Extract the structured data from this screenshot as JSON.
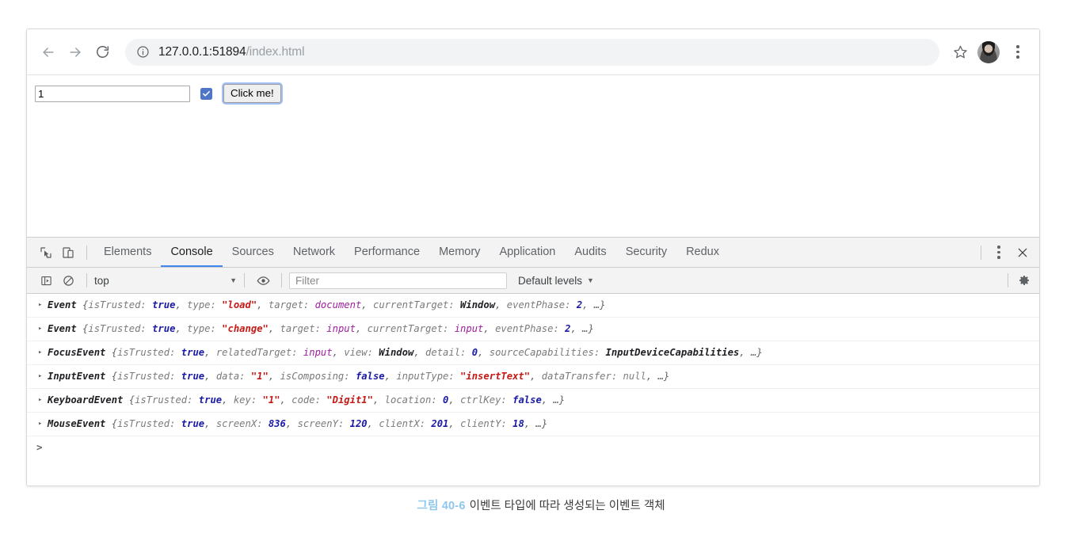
{
  "browser": {
    "back_label": "back-arrow",
    "forward_label": "forward-arrow",
    "reload_label": "reload",
    "url_host": "127.0.0.1:51894",
    "url_path": "/index.html",
    "security_icon": "info-circle-icon",
    "bookmark_icon": "star-icon",
    "profile_icon": "avatar",
    "menu_icon": "three-dot-menu-icon"
  },
  "page": {
    "input_value": "1",
    "input_placeholder": "",
    "checkbox_checked": true,
    "button_label": "Click me!"
  },
  "devtools": {
    "inspect_icon": "inspect-element-icon",
    "device_icon": "device-toolbar-icon",
    "tabs": [
      {
        "label": "Elements",
        "active": false
      },
      {
        "label": "Console",
        "active": true
      },
      {
        "label": "Sources",
        "active": false
      },
      {
        "label": "Network",
        "active": false
      },
      {
        "label": "Performance",
        "active": false
      },
      {
        "label": "Memory",
        "active": false
      },
      {
        "label": "Application",
        "active": false
      },
      {
        "label": "Audits",
        "active": false
      },
      {
        "label": "Security",
        "active": false
      },
      {
        "label": "Redux",
        "active": false
      }
    ],
    "more_icon": "more-options-icon",
    "close_icon": "close-icon",
    "toolbar": {
      "sidebar_icon": "console-sidebar-icon",
      "clear_icon": "clear-console-icon",
      "context": "top",
      "context_caret": "▼",
      "eye_icon": "live-expression-icon",
      "filter_placeholder": "Filter",
      "filter_value": "",
      "levels_label": "Default levels",
      "levels_caret": "▼",
      "settings_icon": "gear-icon"
    },
    "accent_color": "#4285f4",
    "messages": [
      {
        "arrow": "▸",
        "parts": [
          {
            "t": "cls",
            "v": "Event"
          },
          {
            "t": "punc",
            "v": " {"
          },
          {
            "t": "key",
            "v": "isTrusted: "
          },
          {
            "t": "bool",
            "v": "true"
          },
          {
            "t": "punc",
            "v": ", "
          },
          {
            "t": "key",
            "v": "type: "
          },
          {
            "t": "str",
            "v": "\"load\""
          },
          {
            "t": "punc",
            "v": ", "
          },
          {
            "t": "key",
            "v": "target: "
          },
          {
            "t": "ref",
            "v": "document"
          },
          {
            "t": "punc",
            "v": ", "
          },
          {
            "t": "key",
            "v": "currentTarget: "
          },
          {
            "t": "objref",
            "v": "Window"
          },
          {
            "t": "punc",
            "v": ", "
          },
          {
            "t": "key",
            "v": "eventPhase: "
          },
          {
            "t": "num",
            "v": "2"
          },
          {
            "t": "punc",
            "v": ", …}"
          }
        ]
      },
      {
        "arrow": "▸",
        "parts": [
          {
            "t": "cls",
            "v": "Event"
          },
          {
            "t": "punc",
            "v": " {"
          },
          {
            "t": "key",
            "v": "isTrusted: "
          },
          {
            "t": "bool",
            "v": "true"
          },
          {
            "t": "punc",
            "v": ", "
          },
          {
            "t": "key",
            "v": "type: "
          },
          {
            "t": "str",
            "v": "\"change\""
          },
          {
            "t": "punc",
            "v": ", "
          },
          {
            "t": "key",
            "v": "target: "
          },
          {
            "t": "ref",
            "v": "input"
          },
          {
            "t": "punc",
            "v": ", "
          },
          {
            "t": "key",
            "v": "currentTarget: "
          },
          {
            "t": "ref",
            "v": "input"
          },
          {
            "t": "punc",
            "v": ", "
          },
          {
            "t": "key",
            "v": "eventPhase: "
          },
          {
            "t": "num",
            "v": "2"
          },
          {
            "t": "punc",
            "v": ", …}"
          }
        ]
      },
      {
        "arrow": "▸",
        "parts": [
          {
            "t": "cls",
            "v": "FocusEvent"
          },
          {
            "t": "punc",
            "v": " {"
          },
          {
            "t": "key",
            "v": "isTrusted: "
          },
          {
            "t": "bool",
            "v": "true"
          },
          {
            "t": "punc",
            "v": ", "
          },
          {
            "t": "key",
            "v": "relatedTarget: "
          },
          {
            "t": "ref",
            "v": "input"
          },
          {
            "t": "punc",
            "v": ", "
          },
          {
            "t": "key",
            "v": "view: "
          },
          {
            "t": "objref",
            "v": "Window"
          },
          {
            "t": "punc",
            "v": ", "
          },
          {
            "t": "key",
            "v": "detail: "
          },
          {
            "t": "num",
            "v": "0"
          },
          {
            "t": "punc",
            "v": ", "
          },
          {
            "t": "key",
            "v": "sourceCapabilities: "
          },
          {
            "t": "objref",
            "v": "InputDeviceCapabilities"
          },
          {
            "t": "punc",
            "v": ", …}"
          }
        ]
      },
      {
        "arrow": "▸",
        "parts": [
          {
            "t": "cls",
            "v": "InputEvent"
          },
          {
            "t": "punc",
            "v": " {"
          },
          {
            "t": "key",
            "v": "isTrusted: "
          },
          {
            "t": "bool",
            "v": "true"
          },
          {
            "t": "punc",
            "v": ", "
          },
          {
            "t": "key",
            "v": "data: "
          },
          {
            "t": "str",
            "v": "\"1\""
          },
          {
            "t": "punc",
            "v": ", "
          },
          {
            "t": "key",
            "v": "isComposing: "
          },
          {
            "t": "bool",
            "v": "false"
          },
          {
            "t": "punc",
            "v": ", "
          },
          {
            "t": "key",
            "v": "inputType: "
          },
          {
            "t": "str",
            "v": "\"insertText\""
          },
          {
            "t": "punc",
            "v": ", "
          },
          {
            "t": "key",
            "v": "dataTransfer: "
          },
          {
            "t": "nul",
            "v": "null"
          },
          {
            "t": "punc",
            "v": ", …}"
          }
        ]
      },
      {
        "arrow": "▸",
        "parts": [
          {
            "t": "cls",
            "v": "KeyboardEvent"
          },
          {
            "t": "punc",
            "v": " {"
          },
          {
            "t": "key",
            "v": "isTrusted: "
          },
          {
            "t": "bool",
            "v": "true"
          },
          {
            "t": "punc",
            "v": ", "
          },
          {
            "t": "key",
            "v": "key: "
          },
          {
            "t": "str",
            "v": "\"1\""
          },
          {
            "t": "punc",
            "v": ", "
          },
          {
            "t": "key",
            "v": "code: "
          },
          {
            "t": "str",
            "v": "\"Digit1\""
          },
          {
            "t": "punc",
            "v": ", "
          },
          {
            "t": "key",
            "v": "location: "
          },
          {
            "t": "num",
            "v": "0"
          },
          {
            "t": "punc",
            "v": ", "
          },
          {
            "t": "key",
            "v": "ctrlKey: "
          },
          {
            "t": "bool",
            "v": "false"
          },
          {
            "t": "punc",
            "v": ", …}"
          }
        ]
      },
      {
        "arrow": "▸",
        "parts": [
          {
            "t": "cls",
            "v": "MouseEvent"
          },
          {
            "t": "punc",
            "v": " {"
          },
          {
            "t": "key",
            "v": "isTrusted: "
          },
          {
            "t": "bool",
            "v": "true"
          },
          {
            "t": "punc",
            "v": ", "
          },
          {
            "t": "key",
            "v": "screenX: "
          },
          {
            "t": "num",
            "v": "836"
          },
          {
            "t": "punc",
            "v": ", "
          },
          {
            "t": "key",
            "v": "screenY: "
          },
          {
            "t": "num",
            "v": "120"
          },
          {
            "t": "punc",
            "v": ", "
          },
          {
            "t": "key",
            "v": "clientX: "
          },
          {
            "t": "num",
            "v": "201"
          },
          {
            "t": "punc",
            "v": ", "
          },
          {
            "t": "key",
            "v": "clientY: "
          },
          {
            "t": "num",
            "v": "18"
          },
          {
            "t": "punc",
            "v": ", …}"
          }
        ]
      }
    ],
    "prompt_symbol": ">",
    "prompt_value": ""
  },
  "caption": {
    "figure_number": "그림 40-6",
    "text": "이벤트 타입에 따라 생성되는 이벤트 객체"
  }
}
